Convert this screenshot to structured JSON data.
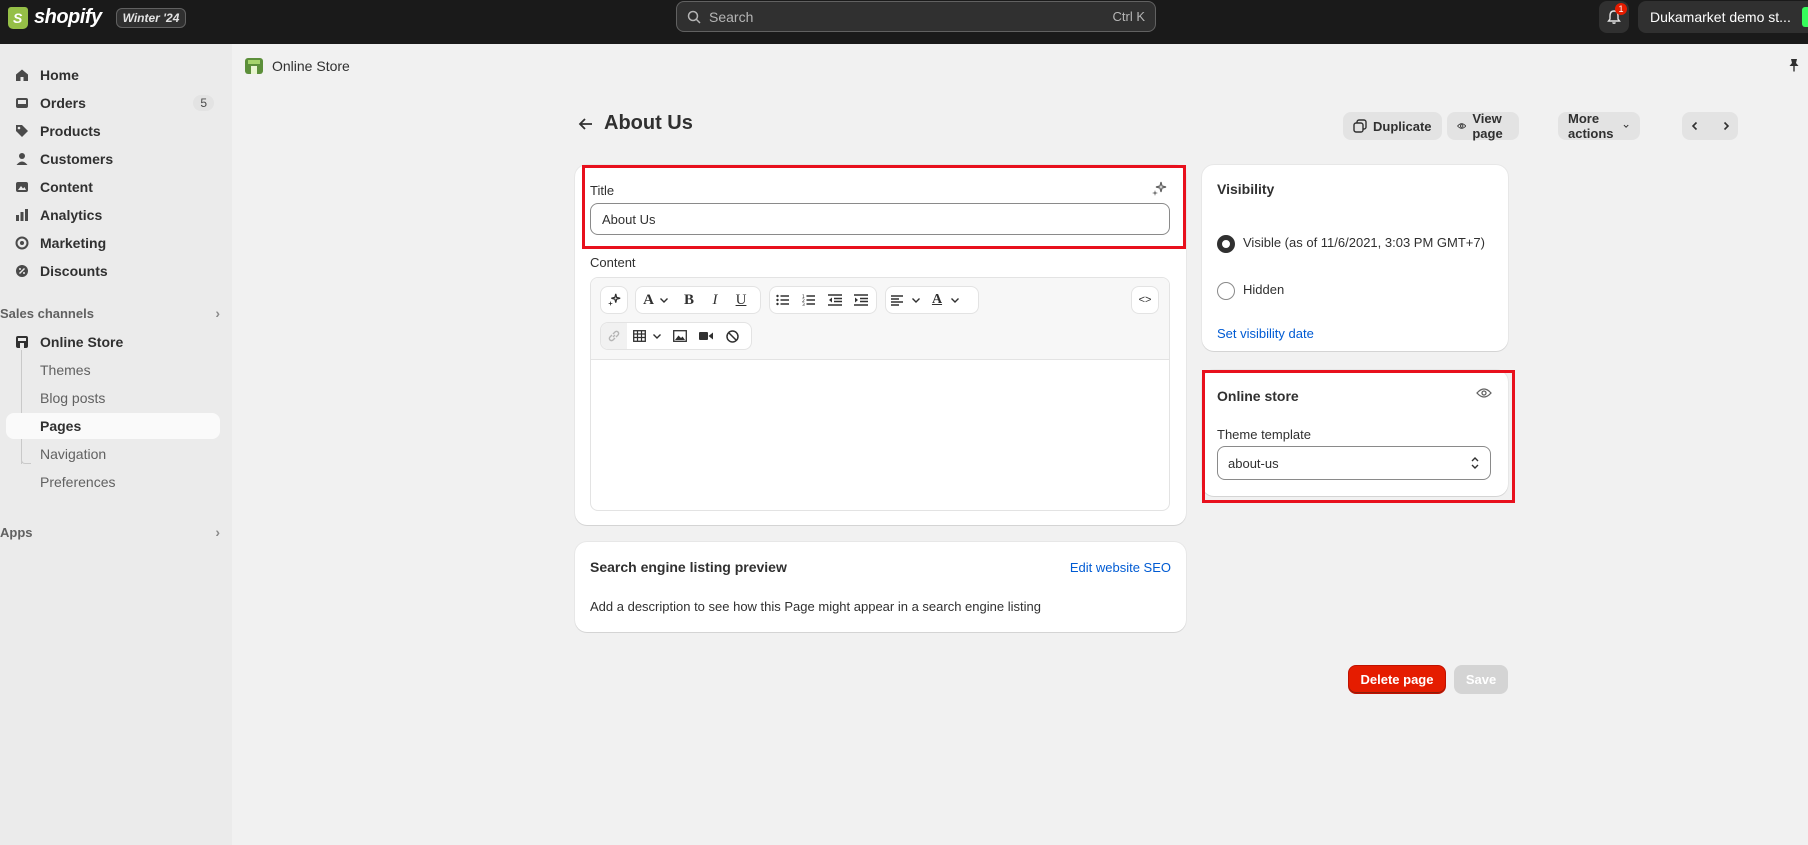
{
  "topbar": {
    "brand": "shopify",
    "edition": "Winter '24",
    "search_placeholder": "Search",
    "search_shortcut": "Ctrl K",
    "notification_count": "1",
    "store_name": "Dukamarket demo st..."
  },
  "sidebar": {
    "items": [
      {
        "label": "Home",
        "icon": "home-icon"
      },
      {
        "label": "Orders",
        "icon": "inbox-icon",
        "count": "5"
      },
      {
        "label": "Products",
        "icon": "tag-icon"
      },
      {
        "label": "Customers",
        "icon": "person-icon"
      },
      {
        "label": "Content",
        "icon": "image-icon"
      },
      {
        "label": "Analytics",
        "icon": "bar-chart-icon"
      },
      {
        "label": "Marketing",
        "icon": "target-icon"
      },
      {
        "label": "Discounts",
        "icon": "discount-icon"
      }
    ],
    "sales_channels_label": "Sales channels",
    "online_store_label": "Online Store",
    "sub_items": [
      "Themes",
      "Blog posts",
      "Pages",
      "Navigation",
      "Preferences"
    ],
    "apps_label": "Apps"
  },
  "breadcrumb": {
    "label": "Online Store"
  },
  "page": {
    "title": "About Us",
    "actions": {
      "duplicate": "Duplicate",
      "view_page": "View page",
      "more_actions": "More actions"
    }
  },
  "title_card": {
    "title_label": "Title",
    "title_value": "About Us",
    "content_label": "Content"
  },
  "seo_card": {
    "heading": "Search engine listing preview",
    "edit_link": "Edit website SEO",
    "description": "Add a description to see how this Page might appear in a search engine listing"
  },
  "visibility_card": {
    "heading": "Visibility",
    "visible_label": "Visible (as of 11/6/2021, 3:03 PM GMT+7)",
    "hidden_label": "Hidden",
    "set_date_link": "Set visibility date"
  },
  "online_store_card": {
    "heading": "Online store",
    "template_label": "Theme template",
    "template_value": "about-us"
  },
  "footer": {
    "delete_label": "Delete page",
    "save_label": "Save"
  },
  "colors": {
    "accent": "#005bd3",
    "danger": "#e51c00",
    "highlight": "#e8101d",
    "topbar": "#1a1a1a"
  }
}
